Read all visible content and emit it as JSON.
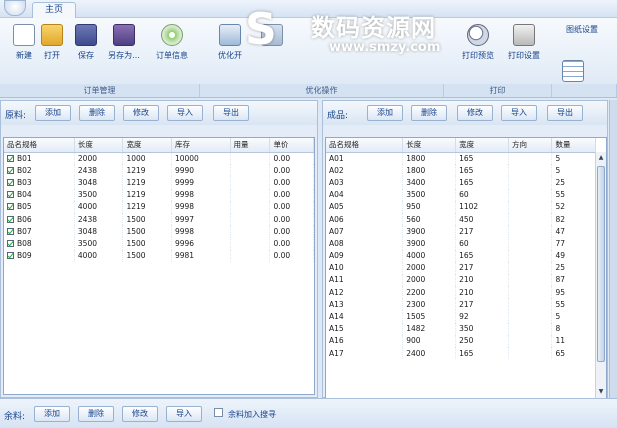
{
  "tabs": [
    {
      "label": "主页"
    }
  ],
  "watermark": {
    "logo": "S",
    "title": "数码资源网",
    "url": "www.smzy.com"
  },
  "ribbon": {
    "buttons": [
      {
        "label": "新建",
        "icon": "new-doc-icon"
      },
      {
        "label": "打开",
        "icon": "folder-open-icon"
      },
      {
        "label": "保存",
        "icon": "save-icon"
      },
      {
        "label": "另存为...",
        "icon": "save-as-icon"
      },
      {
        "label": "订单信息",
        "icon": "order-info-icon"
      },
      {
        "label": "优化开",
        "icon": "optimize-icon"
      },
      {
        "label": "",
        "icon": "generate-icon"
      },
      {
        "label": "打印预览",
        "icon": "magnifier-icon"
      },
      {
        "label": "打印设置",
        "icon": "print-settings-icon"
      },
      {
        "label": "图纸设置",
        "icon": "drawing-settings-icon"
      }
    ],
    "groups": [
      "订单管理",
      "优化操作",
      "打印",
      ""
    ]
  },
  "left_panel": {
    "label": "原料:",
    "buttons": [
      "添加",
      "删除",
      "修改",
      "导入",
      "导出"
    ],
    "columns": [
      "品名规格",
      "长度",
      "宽度",
      "库存",
      "用量",
      "单价"
    ],
    "rows": [
      [
        "B01",
        "2000",
        "1000",
        "10000",
        "",
        "0.00"
      ],
      [
        "B02",
        "2438",
        "1219",
        "9990",
        "",
        "0.00"
      ],
      [
        "B03",
        "3048",
        "1219",
        "9999",
        "",
        "0.00"
      ],
      [
        "B04",
        "3500",
        "1219",
        "9998",
        "",
        "0.00"
      ],
      [
        "B05",
        "4000",
        "1219",
        "9998",
        "",
        "0.00"
      ],
      [
        "B06",
        "2438",
        "1500",
        "9997",
        "",
        "0.00"
      ],
      [
        "B07",
        "3048",
        "1500",
        "9998",
        "",
        "0.00"
      ],
      [
        "B08",
        "3500",
        "1500",
        "9996",
        "",
        "0.00"
      ],
      [
        "B09",
        "4000",
        "1500",
        "9981",
        "",
        "0.00"
      ]
    ]
  },
  "right_panel": {
    "label": "成品:",
    "buttons": [
      "添加",
      "删除",
      "修改",
      "导入",
      "导出"
    ],
    "columns": [
      "品名规格",
      "长度",
      "宽度",
      "方向",
      "数量"
    ],
    "rows": [
      [
        "A01",
        "1800",
        "165",
        "",
        "5"
      ],
      [
        "A02",
        "1800",
        "165",
        "",
        "5"
      ],
      [
        "A03",
        "3400",
        "165",
        "",
        "25"
      ],
      [
        "A04",
        "3500",
        "60",
        "",
        "55"
      ],
      [
        "A05",
        "950",
        "1102",
        "",
        "52"
      ],
      [
        "A06",
        "560",
        "450",
        "",
        "82"
      ],
      [
        "A07",
        "3900",
        "217",
        "",
        "47"
      ],
      [
        "A08",
        "3900",
        "60",
        "",
        "77"
      ],
      [
        "A09",
        "4000",
        "165",
        "",
        "49"
      ],
      [
        "A10",
        "2000",
        "217",
        "",
        "25"
      ],
      [
        "A11",
        "2000",
        "210",
        "",
        "87"
      ],
      [
        "A12",
        "2200",
        "210",
        "",
        "95"
      ],
      [
        "A13",
        "2300",
        "217",
        "",
        "55"
      ],
      [
        "A14",
        "1505",
        "92",
        "",
        "5"
      ],
      [
        "A15",
        "1482",
        "350",
        "",
        "8"
      ],
      [
        "A16",
        "900",
        "250",
        "",
        "11"
      ],
      [
        "A17",
        "2400",
        "165",
        "",
        "65"
      ]
    ]
  },
  "bottom_bar": {
    "label": "余料:",
    "buttons": [
      "添加",
      "删除",
      "修改",
      "导入"
    ],
    "checkbox_label": "余料加入搜寻"
  }
}
